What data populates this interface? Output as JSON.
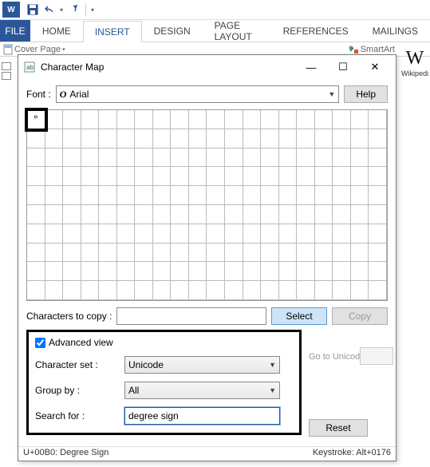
{
  "qat": {
    "save_title": "Save",
    "undo_title": "Undo",
    "redo_title": "Redo",
    "customize_title": "Customize"
  },
  "ribbon": {
    "file": "FILE",
    "tabs": [
      "HOME",
      "INSERT",
      "DESIGN",
      "PAGE LAYOUT",
      "REFERENCES",
      "MAILINGS"
    ],
    "active_index": 1,
    "content_hints": {
      "cover_page": "Cover Page",
      "smartart": "SmartArt"
    }
  },
  "wikipedia": {
    "logo": "W",
    "label": "Wikipedi"
  },
  "dialog": {
    "title": "Character Map",
    "font_label": "Font :",
    "font_value": "Arial",
    "help": "Help",
    "selected_char": "°",
    "copy_label": "Characters to copy :",
    "copy_value": "",
    "select_btn": "Select",
    "copy_btn": "Copy",
    "advanced": {
      "checkbox_label": "Advanced view",
      "checked": true,
      "charset_label": "Character set :",
      "charset_value": "Unicode",
      "group_label": "Group by :",
      "group_value": "All",
      "search_label": "Search for :",
      "search_value": "degree sign",
      "goto_label": "Go to Unicode :",
      "reset": "Reset"
    },
    "status_left": "U+00B0: Degree Sign",
    "status_right": "Keystroke: Alt+0176"
  }
}
